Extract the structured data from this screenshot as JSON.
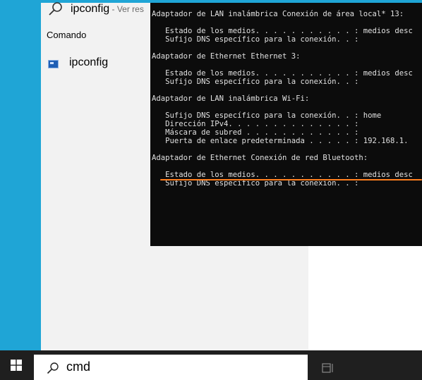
{
  "suggestion": {
    "text": "ipconfig",
    "sub": " - Ver res"
  },
  "results": {
    "section_label": "Comando",
    "top_result_label": "ipconfig"
  },
  "console": {
    "lines": [
      {
        "text": "Adaptador de LAN inalámbrica Conexión de área local* 13:"
      },
      {
        "text": ""
      },
      {
        "text": "   Estado de los medios. . . . . . . . . . . : medios desc"
      },
      {
        "text": "   Sufijo DNS específico para la conexión. . :"
      },
      {
        "text": ""
      },
      {
        "text": "Adaptador de Ethernet Ethernet 3:"
      },
      {
        "text": ""
      },
      {
        "text": "   Estado de los medios. . . . . . . . . . . : medios desc"
      },
      {
        "text": "   Sufijo DNS específico para la conexión. . :"
      },
      {
        "text": ""
      },
      {
        "text": "Adaptador de LAN inalámbrica Wi-Fi:"
      },
      {
        "text": ""
      },
      {
        "text": "   Sufijo DNS específico para la conexión. . : home"
      },
      {
        "text": "   Dirección IPv4. . . . . . . . . . . . . . :"
      },
      {
        "text": "   Máscara de subred . . . . . . . . . . . . :"
      },
      {
        "text": "   Puerta de enlace predeterminada . . . . . : 192.168.1."
      },
      {
        "text": ""
      },
      {
        "text": "Adaptador de Ethernet Conexión de red Bluetooth:"
      },
      {
        "text": ""
      },
      {
        "text": "   Estado de los medios. . . . . . . . . . . : medios desc"
      },
      {
        "text": "   Sufijo DNS específico para la conexión. . :"
      }
    ],
    "highlight_color": "#ff7f1f"
  },
  "taskbar": {
    "search_query": "cmd",
    "start_icon": "windows-logo-icon",
    "search_icon": "search-icon",
    "taskview_icon": "task-view-icon"
  },
  "colors": {
    "accent": "#1fa5d6",
    "panel": "#f2f2f2",
    "console_bg": "#0c0c0c",
    "taskbar_bg": "#1f1f1f"
  }
}
